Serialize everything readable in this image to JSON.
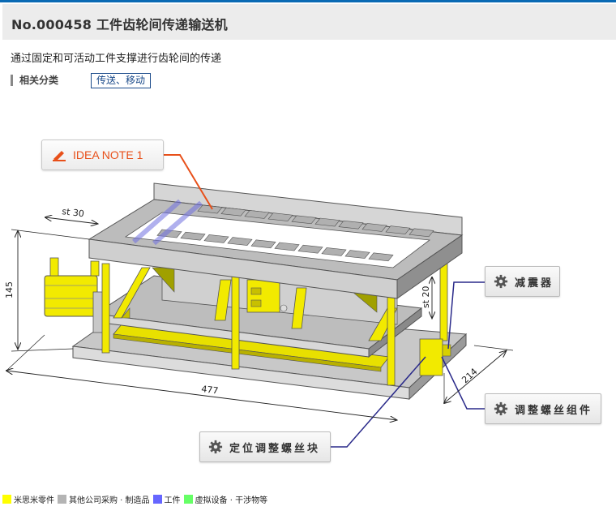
{
  "header": {
    "title": "No.000458 工件齿轮间传递输送机",
    "subtitle": "通过固定和可活动工件支撑进行齿轮间的传递"
  },
  "category": {
    "label": "相关分类",
    "tag": "传送、移动"
  },
  "idea_note": {
    "label": "IDEA NOTE 1",
    "icon": "pencil-icon",
    "color": "#e8501a"
  },
  "callouts": [
    {
      "label": "减震器",
      "icon": "gear-icon"
    },
    {
      "label": "调整螺丝组件",
      "icon": "gear-icon"
    },
    {
      "label": "定位调整螺丝块",
      "icon": "gear-icon"
    }
  ],
  "dimensions": {
    "stroke_x": "st 30",
    "stroke_z": "st 20",
    "height": "145",
    "length": "477",
    "depth": "214"
  },
  "legend": [
    {
      "label": "米思米零件",
      "color": "#ffff00"
    },
    {
      "label": "其他公司采购 · 制造品",
      "color": "#b4b4b4"
    },
    {
      "label": "工件",
      "color": "#6666ff"
    },
    {
      "label": "虚拟设备 · 干涉物等",
      "color": "#66ff66"
    }
  ],
  "colors": {
    "accent": "#0a6ab4",
    "leader_line": "#2a2a8a",
    "idea_line": "#e8501a"
  }
}
